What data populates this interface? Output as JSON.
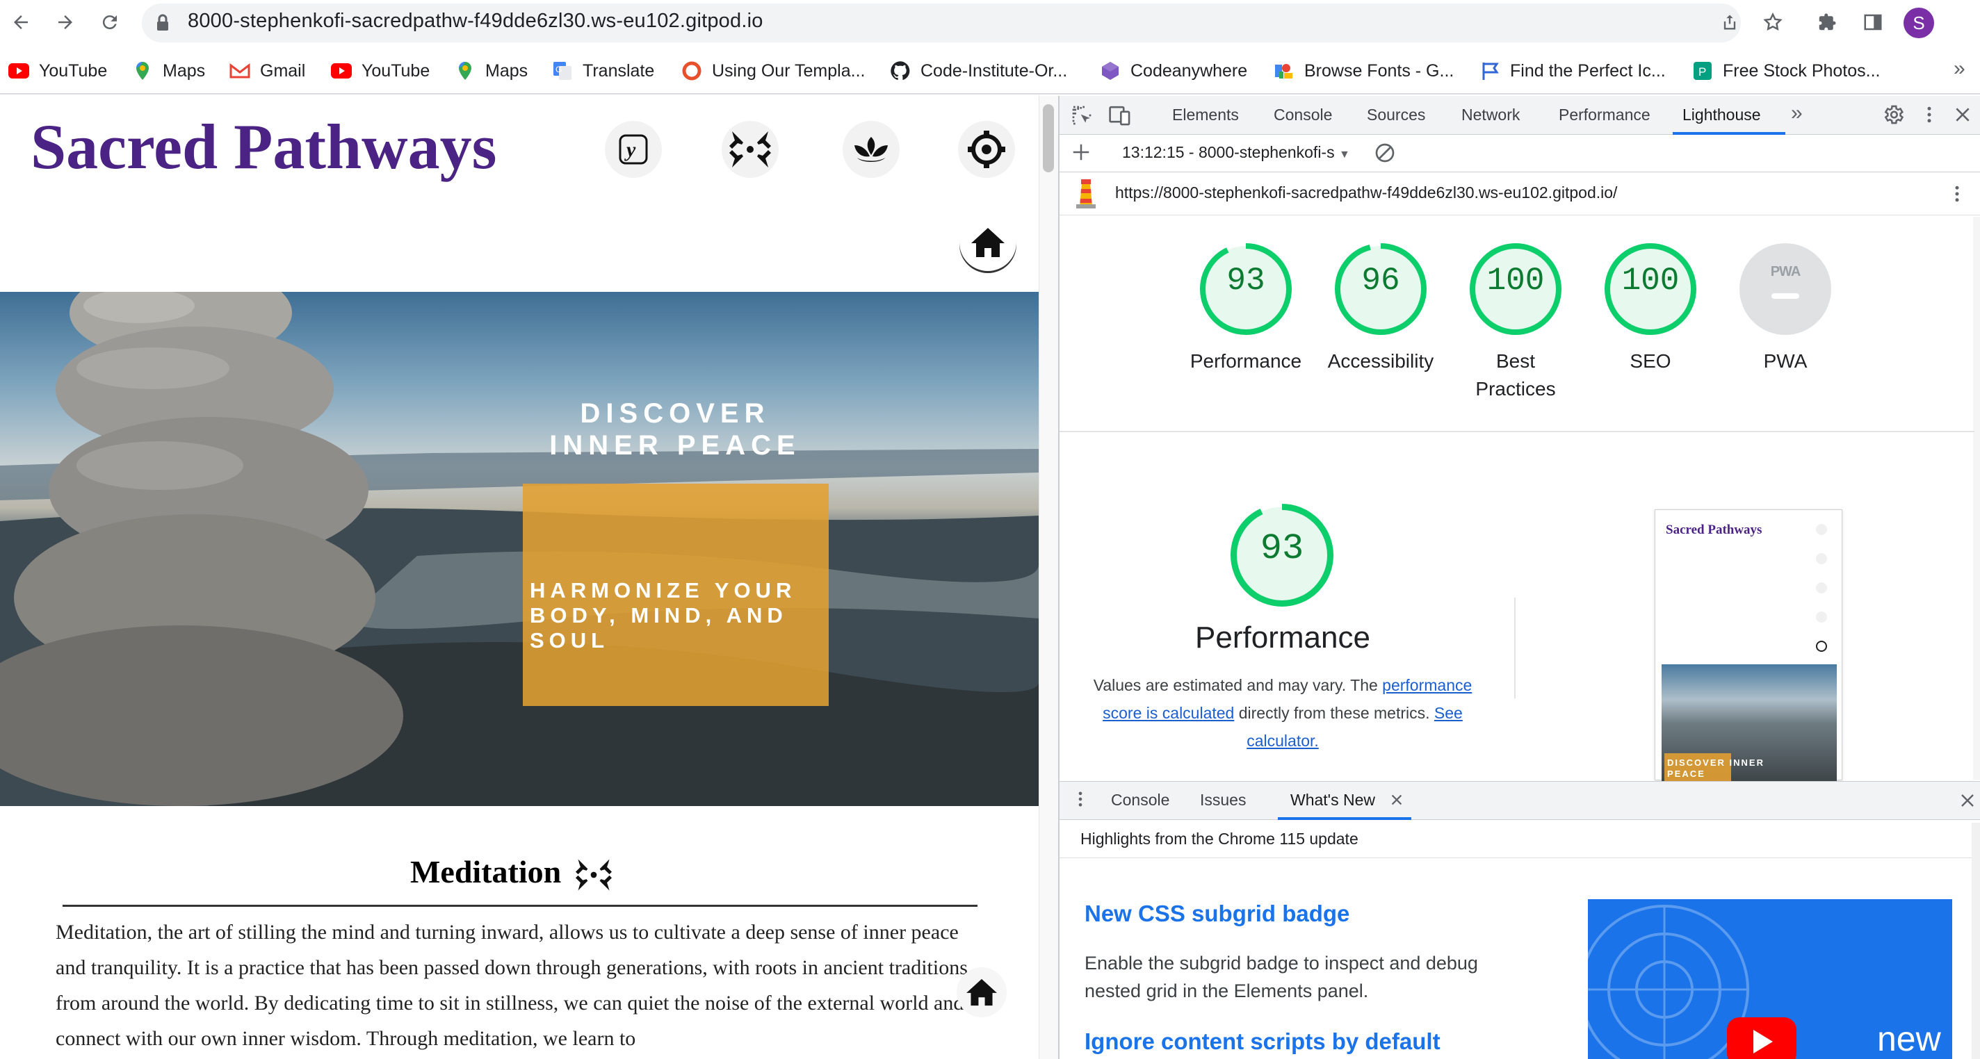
{
  "browser": {
    "url": "8000-stephenkofi-sacredpathw-f49dde6zl30.ws-eu102.gitpod.io",
    "avatar_letter": "S",
    "bookmarks": [
      {
        "label": "YouTube",
        "icon": "youtube-icon"
      },
      {
        "label": "Maps",
        "icon": "maps-icon"
      },
      {
        "label": "Gmail",
        "icon": "gmail-icon"
      },
      {
        "label": "YouTube",
        "icon": "youtube-icon"
      },
      {
        "label": "Maps",
        "icon": "maps-icon"
      },
      {
        "label": "Translate",
        "icon": "translate-icon"
      },
      {
        "label": "Using Our Templa...",
        "icon": "circle-icon"
      },
      {
        "label": "Code-Institute-Or...",
        "icon": "github-icon"
      },
      {
        "label": "Codeanywhere",
        "icon": "cube-icon"
      },
      {
        "label": "Browse Fonts - G...",
        "icon": "fonts-icon"
      },
      {
        "label": "Find the Perfect Ic...",
        "icon": "flag-icon"
      },
      {
        "label": "Free Stock Photos...",
        "icon": "photo-icon"
      }
    ],
    "bookmarks_more": "»"
  },
  "site": {
    "title": "Sacred Pathways",
    "hero_heading": "DISCOVER INNER PEACE",
    "hero_subheading": "HARMONIZE YOUR BODY, MIND, AND SOUL",
    "section_title": "Meditation",
    "section_text": "Meditation, the art of stilling the mind and turning inward, allows us to cultivate a deep sense of inner peace and tranquility. It is a practice that has been passed down through generations, with roots in ancient traditions from around the world. By dedicating time to sit in stillness, we can quiet the noise of the external world and connect with our own inner wisdom. Through meditation, we learn to"
  },
  "devtools": {
    "tabs": [
      "Elements",
      "Console",
      "Sources",
      "Network",
      "Performance",
      "Lighthouse"
    ],
    "active_tab": "Lighthouse",
    "more_tabs": "»",
    "report_select": "13:12:15 - 8000-stephenkofi-s",
    "report_url": "https://8000-stephenkofi-sacredpathw-f49dde6zl30.ws-eu102.gitpod.io/",
    "scores": [
      {
        "label": "Performance",
        "value": "93",
        "fraction": 0.93
      },
      {
        "label": "Accessibility",
        "value": "96",
        "fraction": 0.96
      },
      {
        "label": "Best Practices",
        "value": "100",
        "fraction": 1.0
      },
      {
        "label": "SEO",
        "value": "100",
        "fraction": 1.0
      },
      {
        "label": "PWA",
        "value": "PWA",
        "fraction": 0
      }
    ],
    "performance": {
      "value": "93",
      "fraction": 0.93,
      "label": "Performance",
      "desc_a": "Values are estimated and may vary. The ",
      "desc_link1": "performance score is calculated",
      "desc_b": " directly from these metrics. ",
      "desc_link2": "See calculator."
    },
    "thumbnail": {
      "title": "Sacred Pathways",
      "caption": "DISCOVER INNER PEACE"
    },
    "drawer": {
      "tabs": [
        "Console",
        "Issues",
        "What's New"
      ],
      "active_tab": "What's New",
      "highlights": "Highlights from the Chrome 115 update",
      "item1_title": "New CSS subgrid badge",
      "item1_text": "Enable the subgrid badge to inspect and debug nested grid in the Elements panel.",
      "item2_title": "Ignore content scripts by default",
      "video_label": "new"
    }
  },
  "colors": {
    "brand_purple": "#4b2385",
    "gauge_green": "#0cce6b",
    "gauge_text": "#0c7a30",
    "link_blue": "#1a73e8",
    "hero_callout": "#e2a032"
  }
}
